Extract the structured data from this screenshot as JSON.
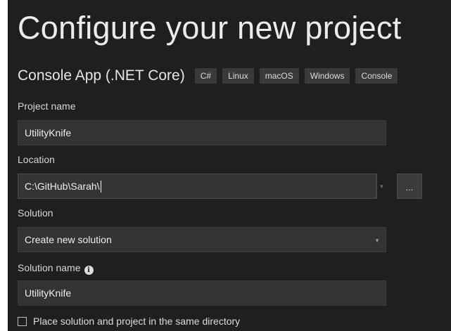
{
  "header": {
    "title": "Configure your new project"
  },
  "template": {
    "name": "Console App (.NET Core)",
    "tags": [
      "C#",
      "Linux",
      "macOS",
      "Windows",
      "Console"
    ]
  },
  "project_name": {
    "label": "Project name",
    "value": "UtilityKnife"
  },
  "location": {
    "label": "Location",
    "value": "C:\\GitHub\\Sarah\\",
    "browse_label": "..."
  },
  "solution": {
    "label": "Solution",
    "value": "Create new solution"
  },
  "solution_name": {
    "label": "Solution name",
    "value": "UtilityKnife"
  },
  "same_directory": {
    "label": "Place solution and project in the same directory",
    "checked": false
  },
  "icons": {
    "info": "info-icon",
    "dropdown": "chevron-down-icon"
  },
  "colors": {
    "background": "#1f1f1f",
    "field": "#333333",
    "tag": "#3a3a3a"
  }
}
